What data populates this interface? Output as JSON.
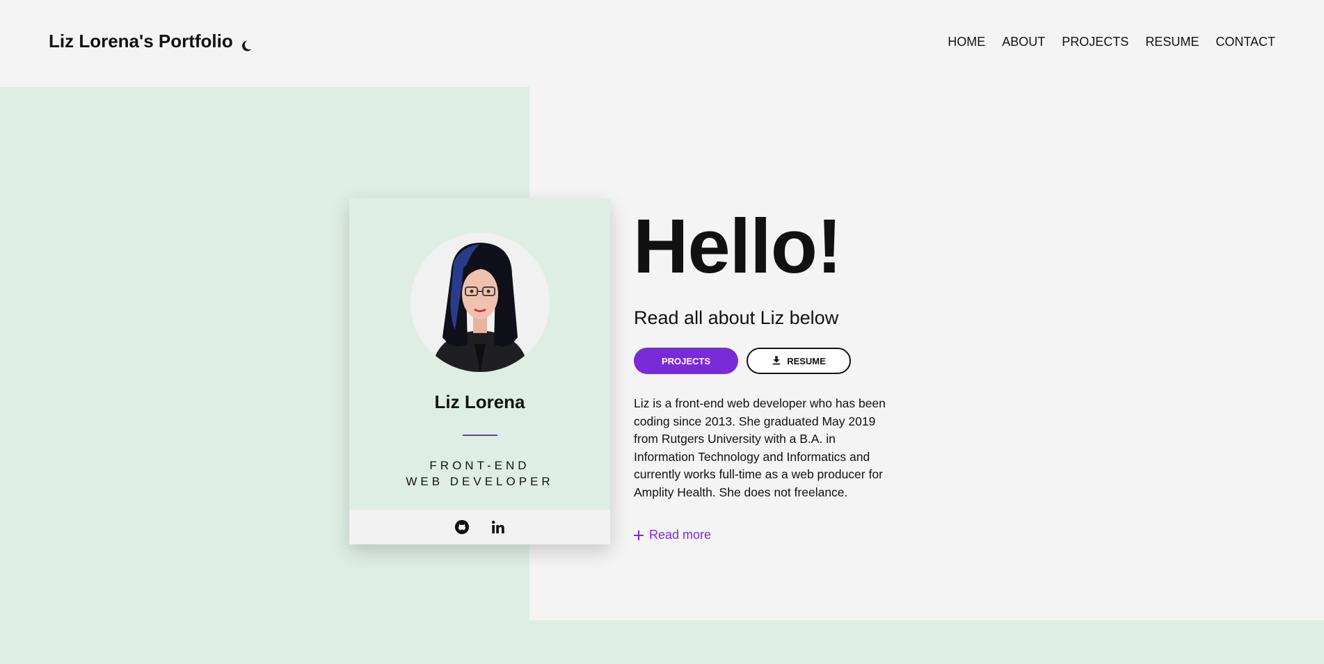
{
  "header": {
    "brand_title": "Liz Lorena's Portfolio",
    "nav": [
      "HOME",
      "ABOUT",
      "PROJECTS",
      "RESUME",
      "CONTACT"
    ]
  },
  "profile_card": {
    "name": "Liz Lorena",
    "title_line1": "FRONT-END",
    "title_line2": "WEB DEVELOPER",
    "social_icons": [
      "github-icon",
      "linkedin-icon"
    ]
  },
  "hero": {
    "headline": "Hello!",
    "subheadline": "Read all about Liz below",
    "projects_button": "PROJECTS",
    "resume_button": "RESUME",
    "description": "Liz is a front-end web developer who has been coding since 2013. She graduated May 2019 from Rutgers University with a B.A. in Information Technology and Informatics and currently works full-time as a web producer for Amplity Health. She does not freelance.",
    "read_more": "Read more"
  },
  "colors": {
    "accent": "#7a2bd9",
    "mint": "#dfeee4",
    "background": "#f4f4f4"
  }
}
